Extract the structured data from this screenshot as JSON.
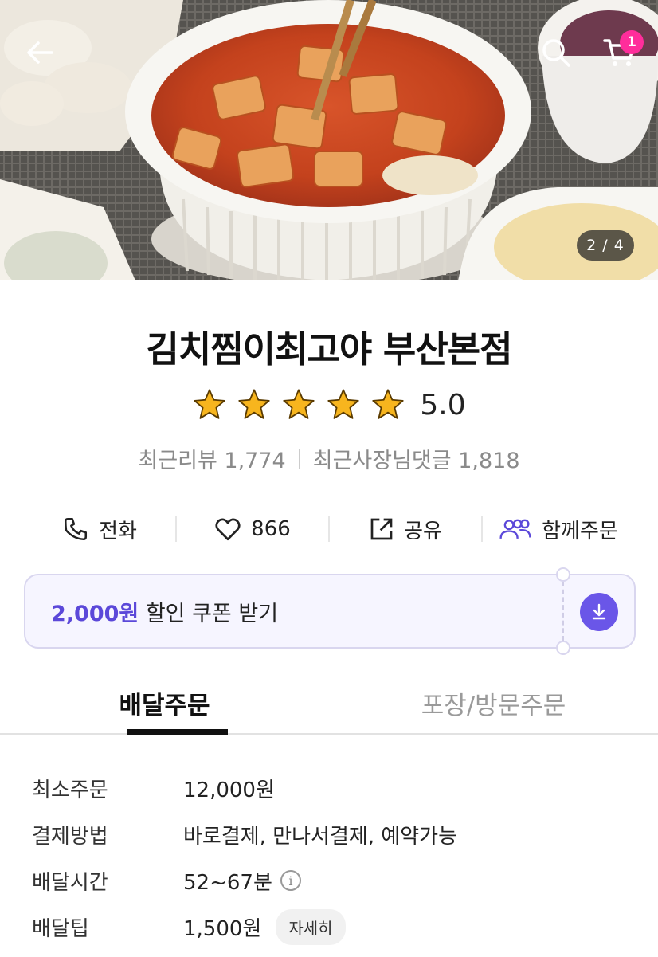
{
  "hero": {
    "page_indicator": "2 / 4",
    "cart_count": "1"
  },
  "store": {
    "name": "김치찜이최고야 부산본점",
    "rating": "5.0",
    "stars_filled": 5,
    "recent_reviews": "최근리뷰 1,774",
    "owner_replies": "최근사장님댓글 1,818"
  },
  "actions": {
    "call": "전화",
    "like_count": "866",
    "share": "공유",
    "group_order": "함께주문"
  },
  "coupon": {
    "amount": "2,000원",
    "text": " 할인 쿠폰 받기"
  },
  "tabs": [
    {
      "label": "배달주문"
    },
    {
      "label": "포장/방문주문"
    }
  ],
  "info": {
    "rows": [
      {
        "label": "최소주문",
        "value": "12,000원"
      },
      {
        "label": "결제방법",
        "value": "바로결제, 만나서결제, 예약가능"
      },
      {
        "label": "배달시간",
        "value": "52~67분"
      },
      {
        "label": "배달팁",
        "value": "1,500원"
      }
    ],
    "detail_label": "자세히"
  },
  "colors": {
    "accent": "#6a56e8",
    "coupon_amount": "#5b48d9",
    "badge": "#ff2d9b",
    "star": "#f7b51e"
  }
}
